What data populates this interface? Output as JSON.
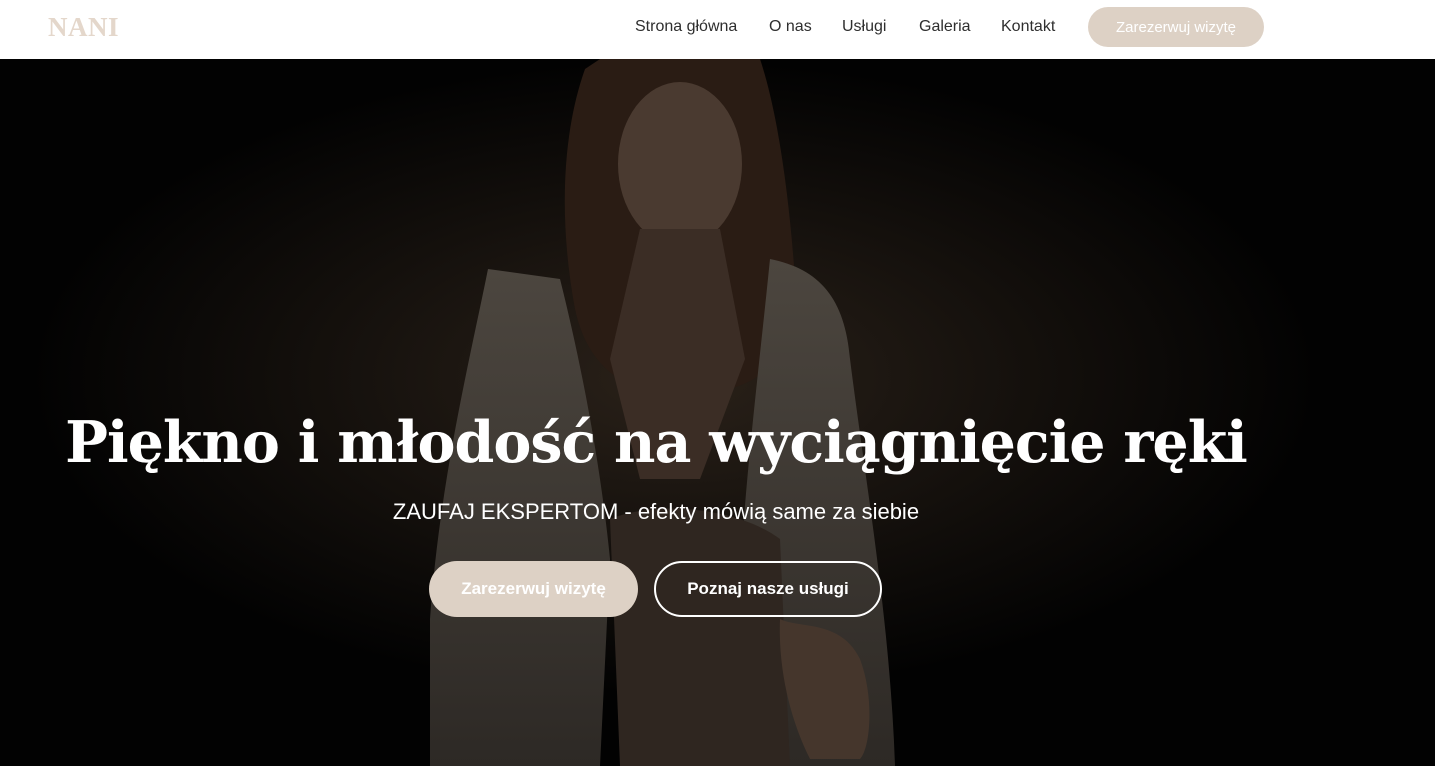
{
  "brand": {
    "logo_text": "NANI"
  },
  "nav": {
    "items": [
      {
        "label": "Strona główna"
      },
      {
        "label": "O nas"
      },
      {
        "label": "Usługi"
      },
      {
        "label": "Galeria"
      },
      {
        "label": "Kontakt"
      }
    ],
    "cta_label": "Zarezerwuj wizytę"
  },
  "hero": {
    "title": "Piękno i młodość na wyciągnięcie ręki",
    "subtitle": "ZAUFAJ EKSPERTOM - efekty mówią same za siebie",
    "primary_button": "Zarezerwuj wizytę",
    "secondary_button": "Poznaj nasze usługi"
  },
  "colors": {
    "accent": "#ddd1c5",
    "logo": "#e4d7cb",
    "hero_background": "#020202",
    "nav_text": "#2e2e2e"
  }
}
